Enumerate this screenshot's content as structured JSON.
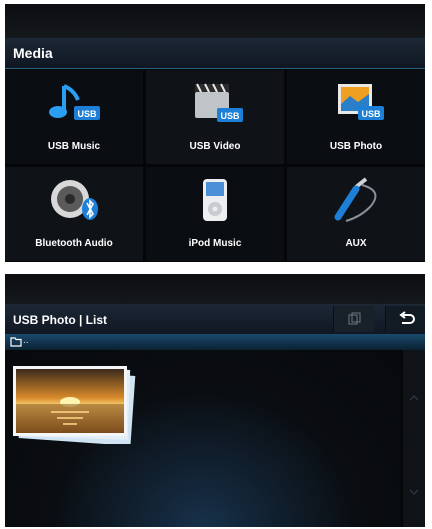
{
  "media_menu": {
    "title": "Media",
    "items": [
      {
        "label": "USB Music",
        "icon": "music-note-usb-icon"
      },
      {
        "label": "USB Video",
        "icon": "clapperboard-usb-icon"
      },
      {
        "label": "USB Photo",
        "icon": "photo-usb-icon"
      },
      {
        "label": "Bluetooth Audio",
        "icon": "speaker-bluetooth-icon"
      },
      {
        "label": "iPod Music",
        "icon": "ipod-icon"
      },
      {
        "label": "AUX",
        "icon": "aux-cable-icon"
      }
    ]
  },
  "photo_list": {
    "title": "USB Photo | List",
    "path": "..",
    "thumbnail_icon": "sunset-photo-thumbnail"
  },
  "colors": {
    "accent_blue": "#1e7fd6",
    "header_bg": "#1d2836",
    "background": "#050608"
  }
}
